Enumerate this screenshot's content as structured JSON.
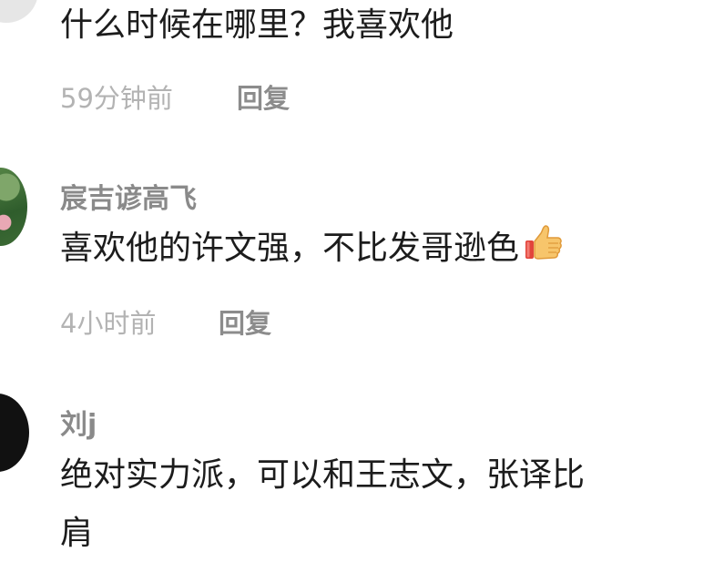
{
  "comments": [
    {
      "text": "什么时候在哪里？我喜欢他",
      "time": "59分钟前",
      "reply": "回复"
    },
    {
      "username": "宸吉谚高飞",
      "text": "喜欢他的许文强，不比发哥逊色",
      "emoji": "thumbs-up",
      "time": "4小时前",
      "reply": "回复"
    },
    {
      "username": "刘j",
      "text_line1": "绝对实力派，可以和王志文，张译比",
      "text_line2": "肩"
    }
  ]
}
